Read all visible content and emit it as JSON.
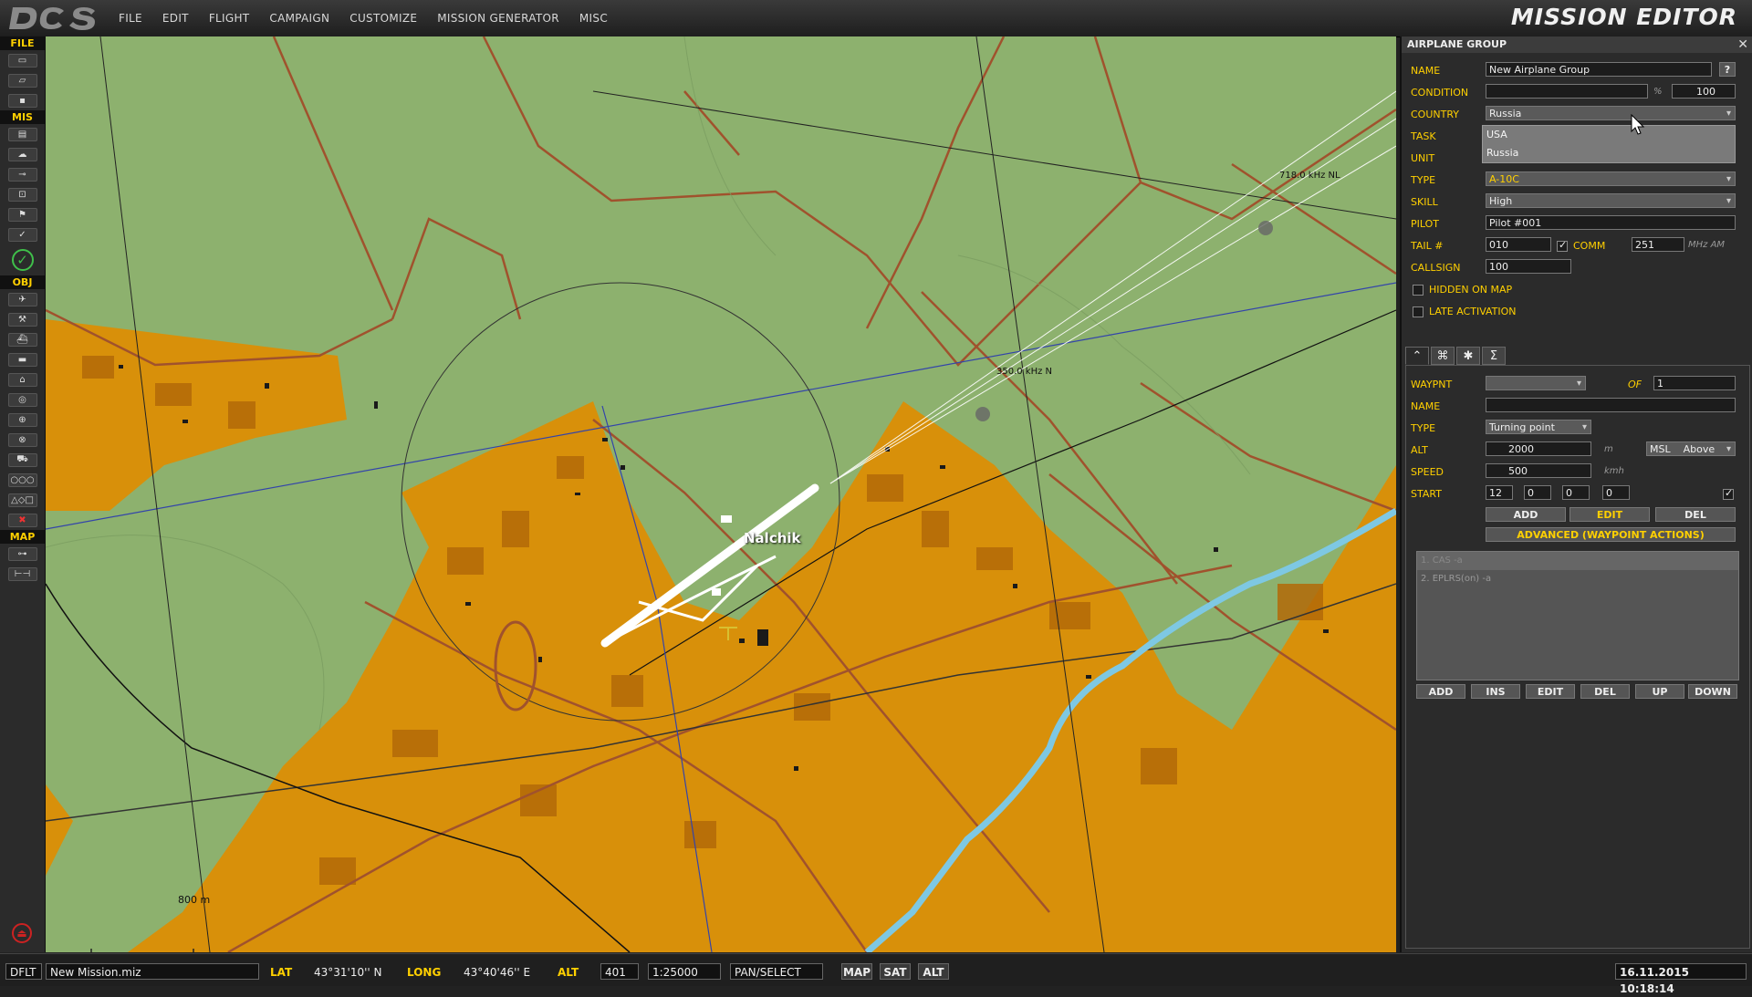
{
  "app": {
    "title": "MISSION EDITOR",
    "logo": "DCS"
  },
  "menu": [
    "FILE",
    "EDIT",
    "FLIGHT",
    "CAMPAIGN",
    "CUSTOMIZE",
    "MISSION GENERATOR",
    "MISC"
  ],
  "toolbar": {
    "sections": [
      "FILE",
      "MIS",
      "OBJ",
      "MAP"
    ]
  },
  "map": {
    "airfield_name": "Nalchik",
    "beacon1": "718.0 kHz NL",
    "beacon2": "350.0 kHz N",
    "scale_label": "800 m",
    "colors": {
      "terrain": "#8db16e",
      "urban": "#d8900a",
      "road": "#a0522d",
      "river": "#7ec8e3",
      "line_blue": "#3344aa"
    }
  },
  "panel": {
    "title": "AIRPLANE GROUP",
    "close": "✕",
    "labels": {
      "name": "NAME",
      "condition": "CONDITION",
      "country": "COUNTRY",
      "task": "TASK",
      "unit": "UNIT",
      "type": "TYPE",
      "skill": "SKILL",
      "pilot": "PILOT",
      "tail": "TAIL #",
      "comm": "COMM",
      "callsign": "CALLSIGN",
      "hidden": "HIDDEN ON MAP",
      "late": "LATE ACTIVATION"
    },
    "name_value": "New Airplane Group",
    "help": "?",
    "condition_value": "",
    "percent": "%",
    "condition_num": "100",
    "country_value": "Russia",
    "country_options": [
      "USA",
      "Russia"
    ],
    "type_value": "A-10C",
    "skill_value": "High",
    "pilot_value": "Pilot #001",
    "tail_value": "010",
    "comm_value": "251",
    "comm_unit": "MHz AM",
    "callsign_value": "100",
    "waypoint": {
      "labels": {
        "waypnt": "WAYPNT",
        "of": "OF",
        "name": "NAME",
        "type": "TYPE",
        "alt": "ALT",
        "speed": "SPEED",
        "start": "START"
      },
      "of_value": "1",
      "name_value": "",
      "type_value": "Turning point",
      "alt_value": "2000",
      "alt_unit": "m",
      "alt_ref": "MSL",
      "alt_mode": "Above",
      "speed_value": "500",
      "speed_unit": "kmh",
      "start": [
        "12",
        "0",
        "0",
        "0"
      ],
      "buttons": {
        "add": "ADD",
        "edit": "EDIT",
        "del": "DEL"
      },
      "advanced": "ADVANCED (WAYPOINT ACTIONS)",
      "actions": [
        "1. CAS -a",
        "2. EPLRS(on) -a"
      ],
      "action_buttons": [
        "ADD",
        "INS",
        "EDIT",
        "DEL",
        "UP",
        "DOWN"
      ]
    }
  },
  "statusbar": {
    "dflt": "DFLT",
    "file": "New Mission.miz",
    "lat_label": "LAT",
    "lat": "43°31'10'' N",
    "long_label": "LONG",
    "long": "43°40'46'' E",
    "alt_label": "ALT",
    "alt": "401",
    "scale": "1:25000",
    "mode": "PAN/SELECT",
    "map_btns": [
      "MAP",
      "SAT",
      "ALT"
    ],
    "datetime": "16.11.2015 10:18:14"
  }
}
